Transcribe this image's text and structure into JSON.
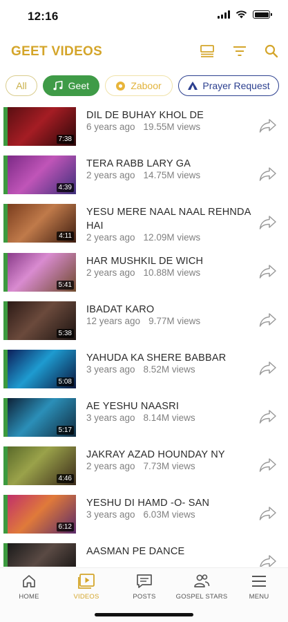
{
  "status_bar": {
    "time": "12:16"
  },
  "header": {
    "title": "GEET VIDEOS",
    "accent_color": "#d4a52a"
  },
  "chips": [
    {
      "label": "All"
    },
    {
      "label": "Geet",
      "selected": true,
      "color": "#3f9b47"
    },
    {
      "label": "Zaboor"
    },
    {
      "label": "Prayer Request"
    }
  ],
  "videos": [
    {
      "title": "DIL DE BUHAY KHOL DE",
      "age": "6 years ago",
      "views": "19.55M views",
      "duration": "7:38"
    },
    {
      "title": "TERA RABB LARY GA",
      "age": "2 years ago",
      "views": "14.75M views",
      "duration": "4:39"
    },
    {
      "title": "YESU MERE NAAL NAAL REHNDA HAI",
      "age": "2 years ago",
      "views": "12.09M views",
      "duration": "4:11"
    },
    {
      "title": "HAR MUSHKIL DE WICH",
      "age": "2 years ago",
      "views": "10.88M views",
      "duration": "5:41"
    },
    {
      "title": "IBADAT KARO",
      "age": "12 years ago",
      "views": "9.77M views",
      "duration": "5:38"
    },
    {
      "title": "YAHUDA KA SHERE BABBAR",
      "age": "3 years ago",
      "views": "8.52M views",
      "duration": "5:08"
    },
    {
      "title": "AE YESHU NAASRI",
      "age": "3 years ago",
      "views": "8.14M views",
      "duration": "5:17"
    },
    {
      "title": "JAKRAY AZAD HOUNDAY NY",
      "age": "2 years ago",
      "views": "7.73M views",
      "duration": "4:46"
    },
    {
      "title": "YESHU DI HAMD -O- SAN",
      "age": "3 years ago",
      "views": "6.03M views",
      "duration": "6:12"
    },
    {
      "title": "AASMAN PE DANCE",
      "age": "",
      "views": "",
      "duration": ""
    }
  ],
  "bottom_nav": [
    {
      "label": "HOME",
      "icon": "home-icon"
    },
    {
      "label": "VIDEOS",
      "icon": "video-icon",
      "active": true
    },
    {
      "label": "POSTS",
      "icon": "chat-icon"
    },
    {
      "label": "GOSPEL STARS",
      "icon": "people-icon"
    },
    {
      "label": "MENU",
      "icon": "menu-icon"
    }
  ]
}
